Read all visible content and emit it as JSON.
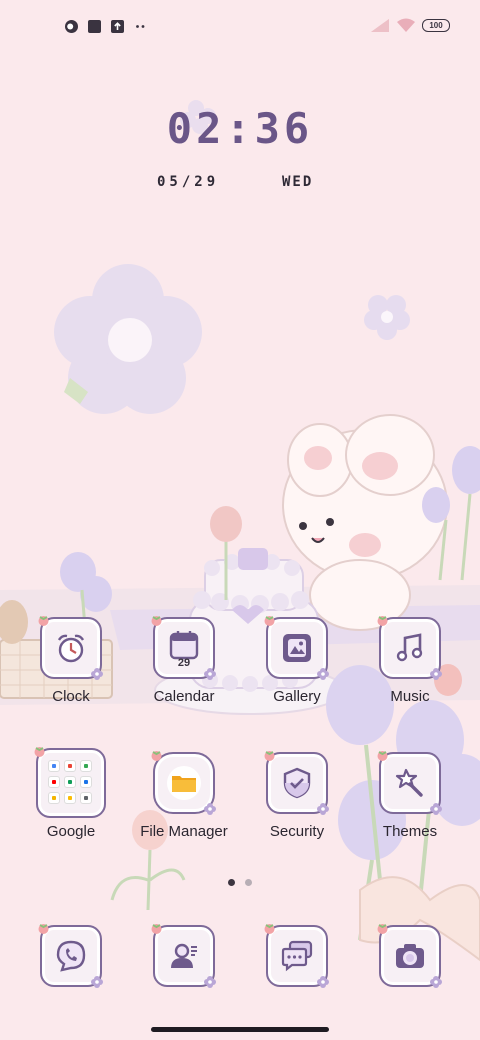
{
  "status_bar": {
    "left_icons": [
      "notification-circle-icon",
      "notification-square-icon",
      "upload-icon",
      "more-dots-icon"
    ],
    "battery": "100",
    "right_icons": [
      "signal-icon",
      "wifi-icon",
      "battery-icon"
    ]
  },
  "clock": {
    "time": "02:36",
    "date": "05/29",
    "day": "WED"
  },
  "apps": {
    "row1": [
      {
        "label": "Clock",
        "icon": "alarm-clock-icon"
      },
      {
        "label": "Calendar",
        "icon": "calendar-icon",
        "date_num": "29"
      },
      {
        "label": "Gallery",
        "icon": "gallery-icon"
      },
      {
        "label": "Music",
        "icon": "music-note-icon"
      }
    ],
    "row2": [
      {
        "label": "Google",
        "icon": "google-folder-icon"
      },
      {
        "label": "File Manager",
        "icon": "folder-icon"
      },
      {
        "label": "Security",
        "icon": "shield-check-icon"
      },
      {
        "label": "Themes",
        "icon": "magic-wand-icon"
      }
    ],
    "dock": [
      {
        "icon": "phone-icon"
      },
      {
        "icon": "contacts-icon"
      },
      {
        "icon": "messages-icon"
      },
      {
        "icon": "camera-icon"
      }
    ]
  },
  "page_indicator": {
    "pages": 2,
    "active": 1
  },
  "colors": {
    "background": "#fbe9ec",
    "accent": "#7e6a99",
    "clock_time": "#6a5688"
  }
}
